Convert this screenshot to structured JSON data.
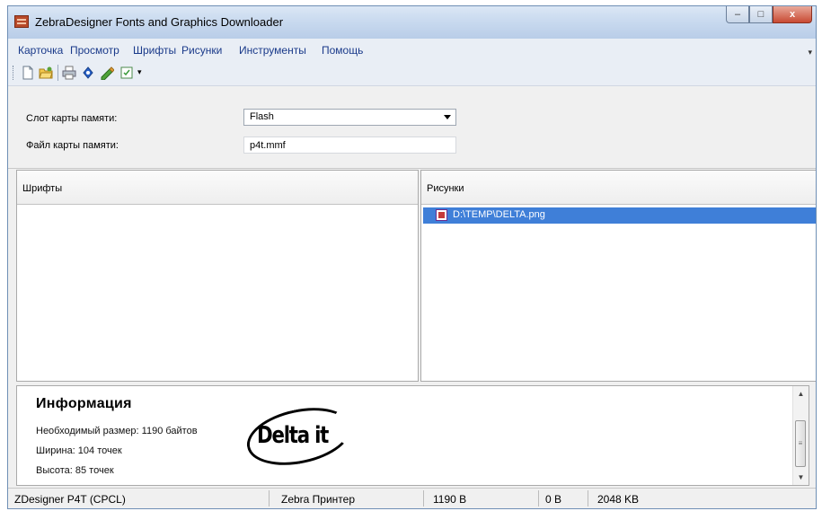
{
  "window": {
    "title": "ZebraDesigner Fonts and Graphics Downloader",
    "controls": {
      "minimize": "–",
      "maximize": "□",
      "close": "x"
    }
  },
  "menu": {
    "items": [
      "Карточка",
      "Просмотр",
      "Шрифты",
      "Рисунки",
      "Инструменты",
      "Помощь"
    ],
    "overflow": "▾"
  },
  "toolbar": {
    "icons": [
      "new-icon",
      "open-icon",
      "print-icon",
      "add-font-icon",
      "add-graphic-icon",
      "properties-icon"
    ],
    "overflow": "▾"
  },
  "form": {
    "slot_label": "Слот карты памяти:",
    "slot_value": "Flash",
    "file_label": "Файл карты памяти:",
    "file_value": "p4t.mmf"
  },
  "fonts_pane": {
    "header": "Шрифты",
    "items": []
  },
  "images_pane": {
    "header": "Рисунки",
    "items": [
      {
        "label": "D:\\TEMP\\DELTA.png",
        "selected": true
      }
    ]
  },
  "info": {
    "title": "Информация",
    "size": "Необходимый размер: 1190 байтов",
    "width": "Ширина: 104 точек",
    "height": "Высота: 85 точек",
    "logo_text": "Delta it"
  },
  "status": {
    "printer": "ZDesigner P4T (CPCL)",
    "type": "Zebra Принтер",
    "required": "1190 B",
    "used": "0 B",
    "capacity": "2048 KB"
  },
  "colors": {
    "selection": "#3f7fd8",
    "menu_text": "#1a3a8a",
    "close_button": "#c84a33"
  }
}
